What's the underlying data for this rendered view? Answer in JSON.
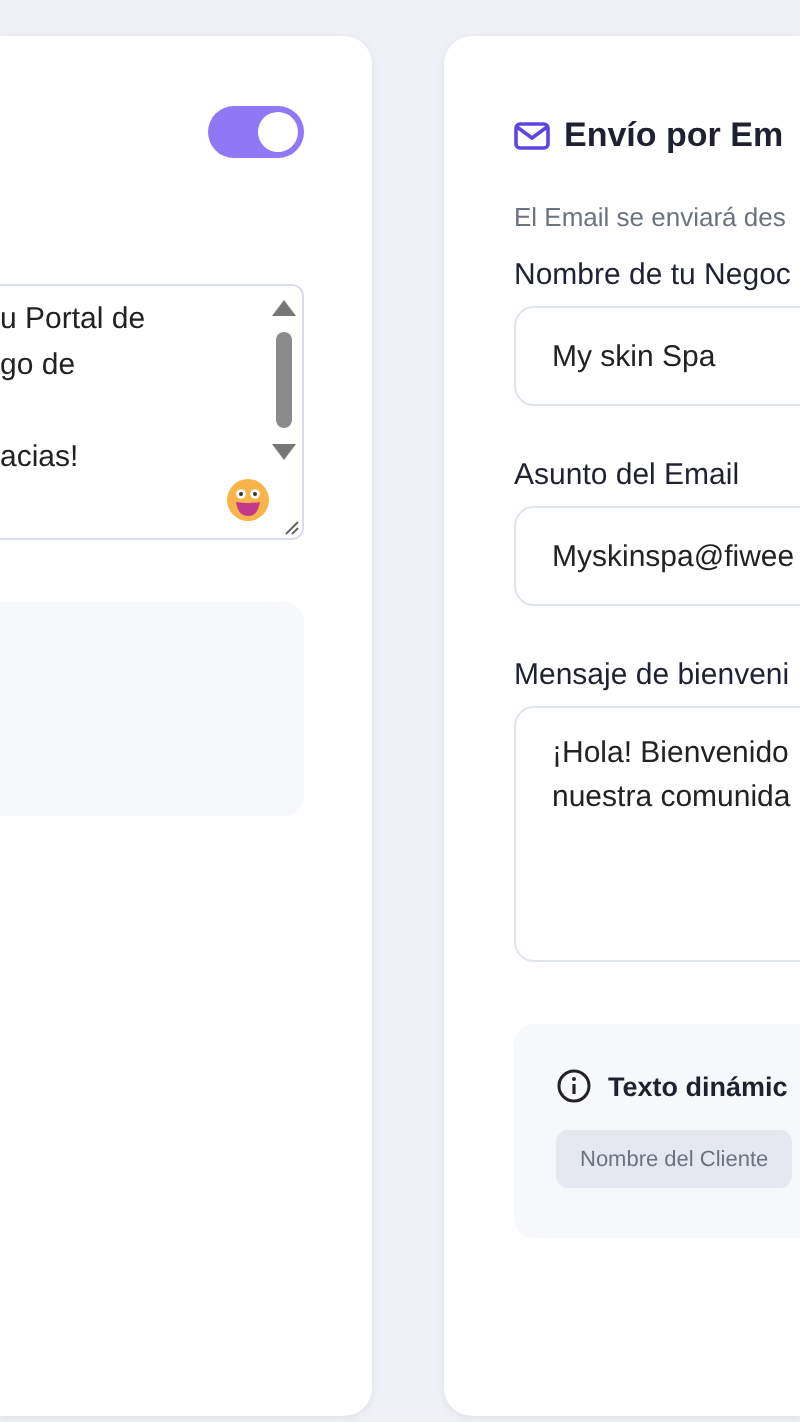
{
  "left_panel": {
    "toggle": {
      "on": true
    },
    "message": {
      "value": "u Portal de\ngo de\n\nacias!"
    }
  },
  "email_panel": {
    "title": "Envío por Em",
    "description": "El Email se enviará des",
    "fields": [
      {
        "label": "Nombre de tu Negoc",
        "value": "My skin Spa",
        "kind": "input"
      },
      {
        "label": "Asunto del Email",
        "value": "Myskinspa@fiwee",
        "kind": "input"
      },
      {
        "label": "Mensaje de bienveni",
        "value": "¡Hola! Bienvenido\nnuestra comunida",
        "kind": "textarea"
      }
    ],
    "dynamic_text": {
      "title": "Texto dinámic",
      "chips": [
        "Nombre del Cliente"
      ]
    }
  }
}
